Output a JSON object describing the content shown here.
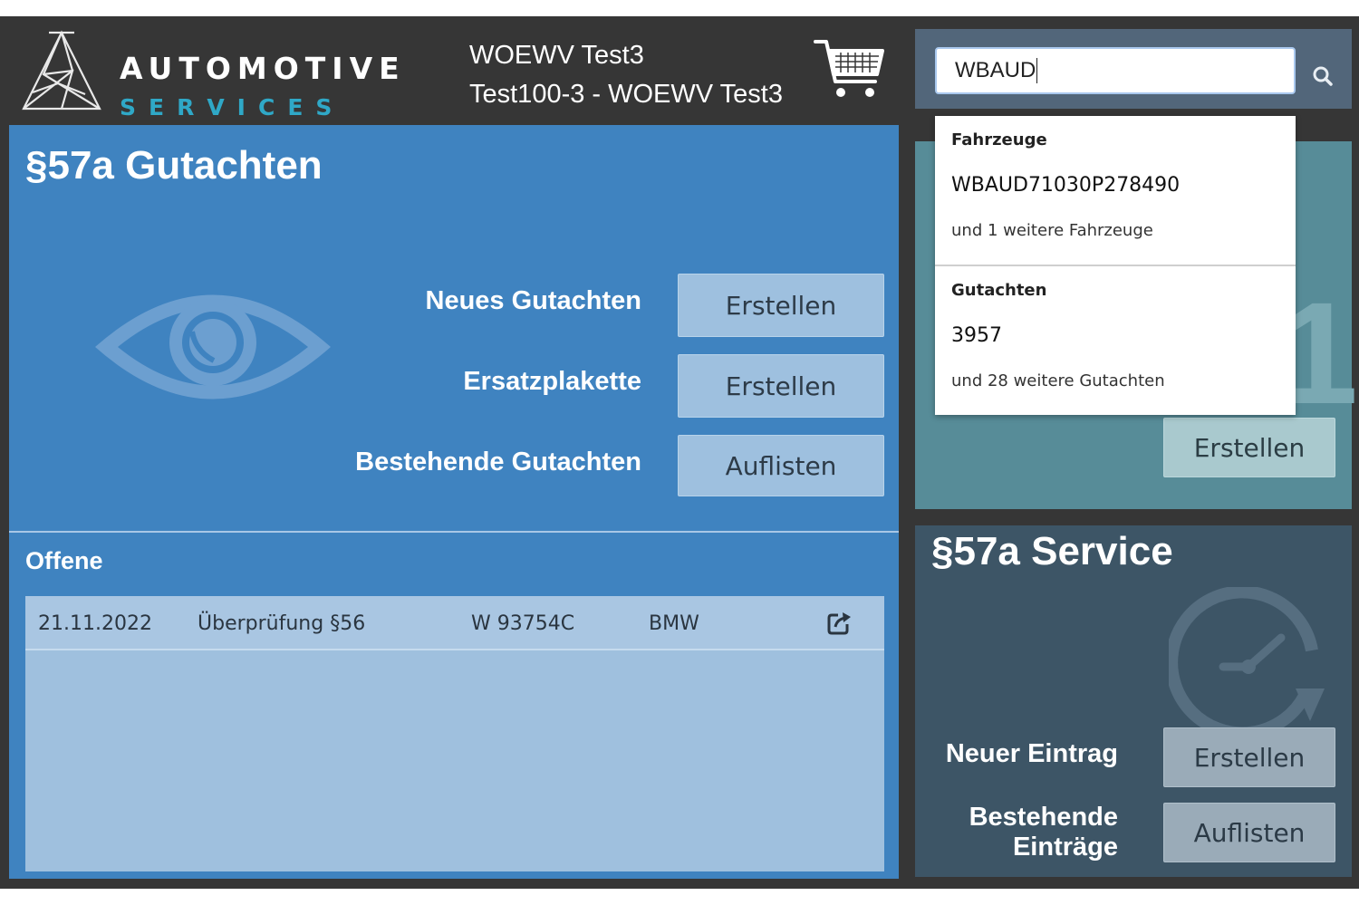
{
  "brand": {
    "line1": "AUTOMOTIVE",
    "line2": "SERVICES",
    "accent": "#2fa8c7"
  },
  "header": {
    "user_line1": "WOEWV Test3",
    "user_line2": "Test100-3 - WOEWV Test3",
    "cart_icon": "cart-icon"
  },
  "search": {
    "value": "WBAUD",
    "icon": "search-icon"
  },
  "dropdown": {
    "vehicles_heading": "Fahrzeuge",
    "vehicle_match": "WBAUD71030P278490",
    "vehicles_more": "und 1 weitere Fahrzeuge",
    "reports_heading": "Gutachten",
    "report_match": "3957",
    "reports_more": "und 28 weitere Gutachten"
  },
  "gutachten": {
    "title": "§57a Gutachten",
    "rows": [
      {
        "label": "Neues Gutachten",
        "button": "Erstellen"
      },
      {
        "label": "Ersatzplakette",
        "button": "Erstellen"
      },
      {
        "label": "Bestehende Gutachten",
        "button": "Auflisten"
      }
    ],
    "panel_color": "#3f83c0"
  },
  "offene": {
    "title": "Offene",
    "rows": [
      {
        "date": "21.11.2022",
        "type": "Überprüfung §56",
        "plate": "W 93754C",
        "make": "BMW"
      }
    ]
  },
  "teal_panel": {
    "button": "Erstellen",
    "color": "#578c98"
  },
  "service": {
    "title": "§57a Service",
    "rows": [
      {
        "label": "Neuer Eintrag",
        "button": "Erstellen"
      },
      {
        "label_line1": "Bestehende",
        "label_line2": "Einträge",
        "button": "Auflisten"
      }
    ],
    "color": "#3d5566"
  }
}
